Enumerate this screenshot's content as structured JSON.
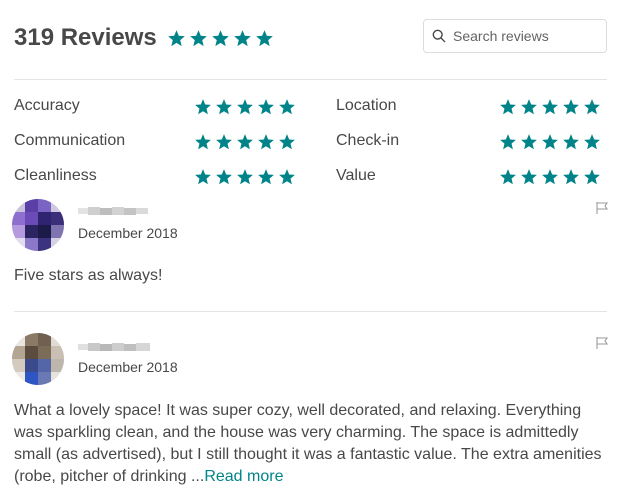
{
  "header": {
    "title": "319 Reviews",
    "overall_rating": 5,
    "star_color": "#008489"
  },
  "search": {
    "placeholder": "Search reviews"
  },
  "categories": [
    {
      "label": "Accuracy",
      "rating": 5
    },
    {
      "label": "Location",
      "rating": 5
    },
    {
      "label": "Communication",
      "rating": 5
    },
    {
      "label": "Check-in",
      "rating": 5
    },
    {
      "label": "Cleanliness",
      "rating": 5
    },
    {
      "label": "Value",
      "rating": 5
    }
  ],
  "reviews": [
    {
      "date": "December 2018",
      "text": "Five stars as always!"
    },
    {
      "date": "December 2018",
      "text": "What a lovely space! It was super cozy, well decorated, and relaxing. Everything was sparkling clean, and the house was very charming. The space is admittedly small (as advertised), but I still thought it was a fantastic value. The extra amenities (robe, pitcher of drinking ...",
      "read_more": "Read more"
    }
  ],
  "icons": {
    "search": "search-icon",
    "flag": "flag-icon",
    "star": "star-icon"
  }
}
